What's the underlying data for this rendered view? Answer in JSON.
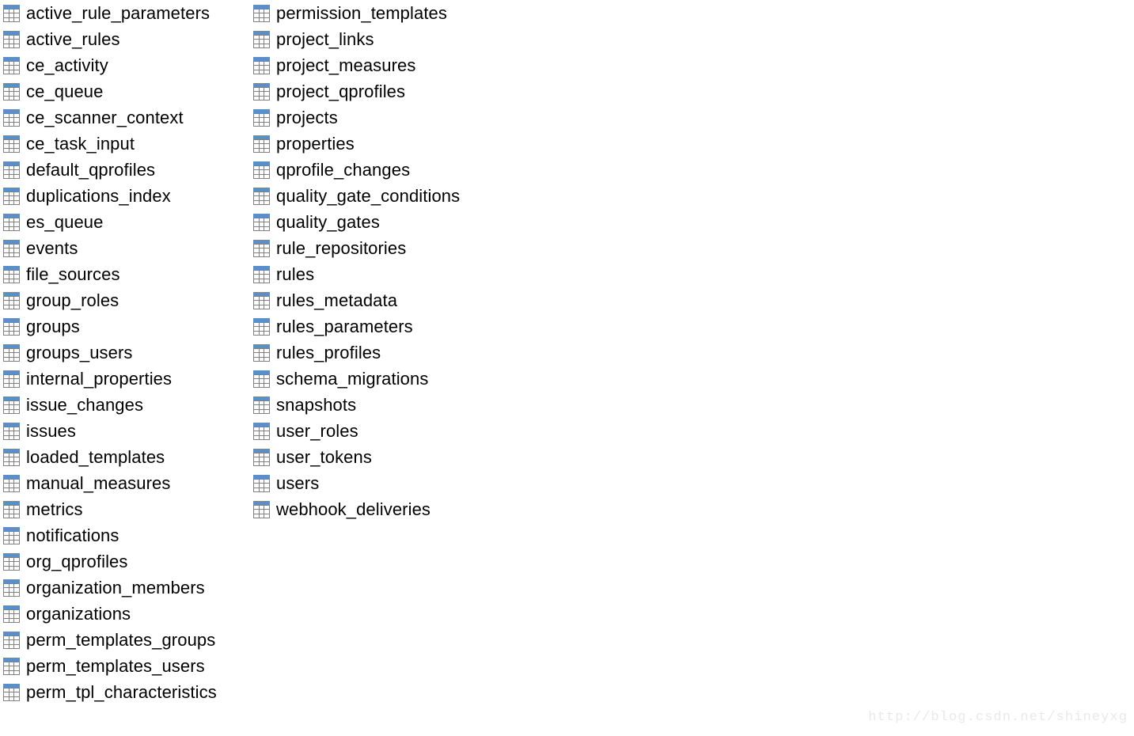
{
  "background_color": "#ffffff",
  "text_color": "#000000",
  "icon": {
    "name": "database-table-icon",
    "header_color": "#5b8fc7",
    "grid_color": "#808080",
    "cell_color": "#ffffff",
    "columns": 3,
    "rows": 3
  },
  "table_list": {
    "columns": [
      {
        "name": "table-column-1",
        "items": [
          "active_rule_parameters",
          "active_rules",
          "ce_activity",
          "ce_queue",
          "ce_scanner_context",
          "ce_task_input",
          "default_qprofiles",
          "duplications_index",
          "es_queue",
          "events",
          "file_sources",
          "group_roles",
          "groups",
          "groups_users",
          "internal_properties",
          "issue_changes",
          "issues",
          "loaded_templates",
          "manual_measures",
          "metrics",
          "notifications",
          "org_qprofiles",
          "organization_members",
          "organizations",
          "perm_templates_groups",
          "perm_templates_users",
          "perm_tpl_characteristics"
        ]
      },
      {
        "name": "table-column-2",
        "items": [
          "permission_templates",
          "project_links",
          "project_measures",
          "project_qprofiles",
          "projects",
          "properties",
          "qprofile_changes",
          "quality_gate_conditions",
          "quality_gates",
          "rule_repositories",
          "rules",
          "rules_metadata",
          "rules_parameters",
          "rules_profiles",
          "schema_migrations",
          "snapshots",
          "user_roles",
          "user_tokens",
          "users",
          "webhook_deliveries"
        ]
      }
    ]
  },
  "watermark": {
    "text": "http://blog.csdn.net/shineyxg",
    "color": "#e9e9e9"
  }
}
